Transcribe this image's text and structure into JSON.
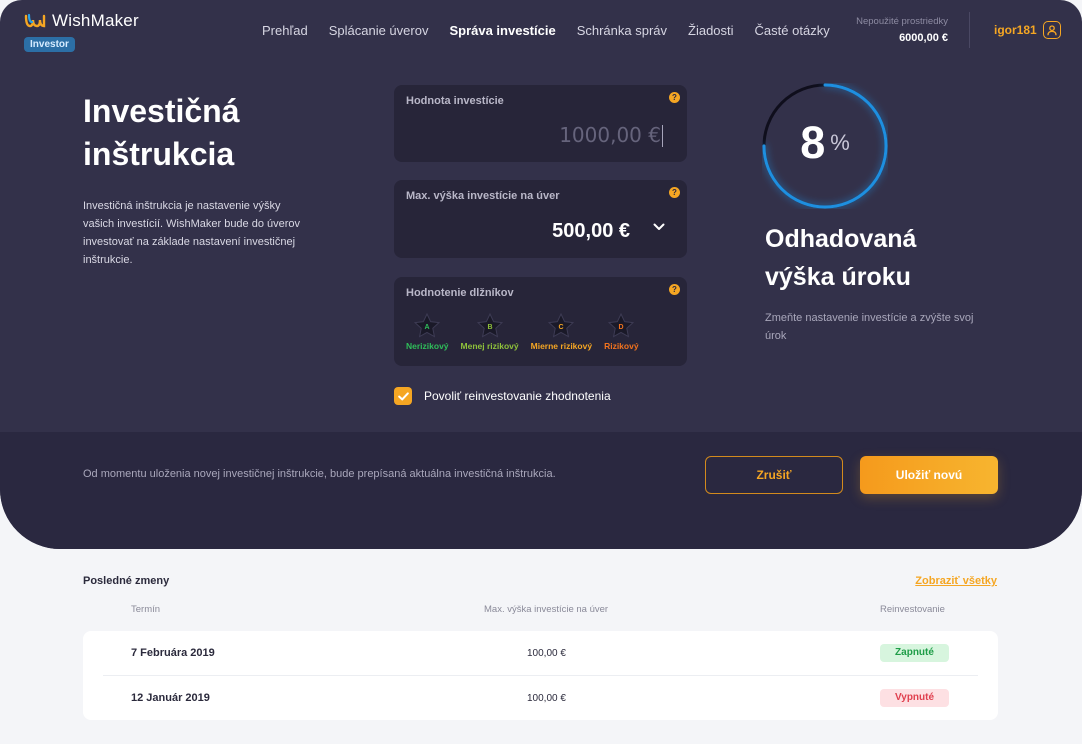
{
  "header": {
    "logo_text": "WishMaker",
    "role_badge": "Investor",
    "nav": [
      {
        "label": "Prehľad",
        "active": false
      },
      {
        "label": "Splácanie úverov",
        "active": false
      },
      {
        "label": "Správa investície",
        "active": true
      },
      {
        "label": "Schránka správ",
        "active": false
      },
      {
        "label": "Žiadosti",
        "active": false
      },
      {
        "label": "Časté otázky",
        "active": false
      }
    ],
    "funds_label": "Nepoužité prostriedky",
    "funds_value": "6000,00 €",
    "username": "igor181"
  },
  "intro": {
    "title": "Investičná inštrukcia",
    "description": "Investičná inštrukcia je nastavenie výšky vašich investícií. WishMaker bude do úverov investovať  na základe nastavení investičnej inštrukcie."
  },
  "form": {
    "investment_label": "Hodnota investície",
    "investment_placeholder": "1000,00 €",
    "max_label": "Max. výška investície na úver",
    "max_value": "500,00 €",
    "rating_label": "Hodnotenie dlžníkov",
    "help_symbol": "?",
    "ratings": [
      {
        "grade": "A",
        "name": "Nerizikový",
        "color": "#2fbf5a"
      },
      {
        "grade": "B",
        "name": "Menej rizikový",
        "color": "#8fc23a"
      },
      {
        "grade": "C",
        "name": "Mierne rizikový",
        "color": "#f5a623"
      },
      {
        "grade": "D",
        "name": "Rizikový",
        "color": "#f2731e"
      }
    ],
    "reinvest_label": "Povoliť reinvestovanie zhodnotenia",
    "reinvest_checked": true
  },
  "estimate": {
    "value": "8",
    "unit": "%",
    "fraction": 0.08,
    "title": "Odhadovaná výška úroku",
    "description": "Zmeňte nastavenie investície a zvýšte svoj úrok"
  },
  "footer_bar": {
    "note": "Od momentu uloženia novej investičnej inštrukcie, bude prepísaná aktuálna investičná inštrukcia.",
    "cancel_label": "Zrušiť",
    "save_label": "Uložiť novú"
  },
  "changes": {
    "title": "Posledné zmeny",
    "show_all": "Zobraziť všetky",
    "columns": [
      "Termín",
      "Max. výška investície na úver",
      "Reinvestovanie"
    ],
    "rows": [
      {
        "date": "7 Februára 2019",
        "amount": "100,00 €",
        "status": "Zapnuté",
        "state": "on"
      },
      {
        "date": "12 Január 2019",
        "amount": "100,00 €",
        "status": "Vypnuté",
        "state": "off"
      }
    ]
  },
  "colors": {
    "accent": "#f5a623",
    "hero_bg": "#33314a",
    "card_bg": "#272539",
    "ring": "#1e8fe0"
  }
}
